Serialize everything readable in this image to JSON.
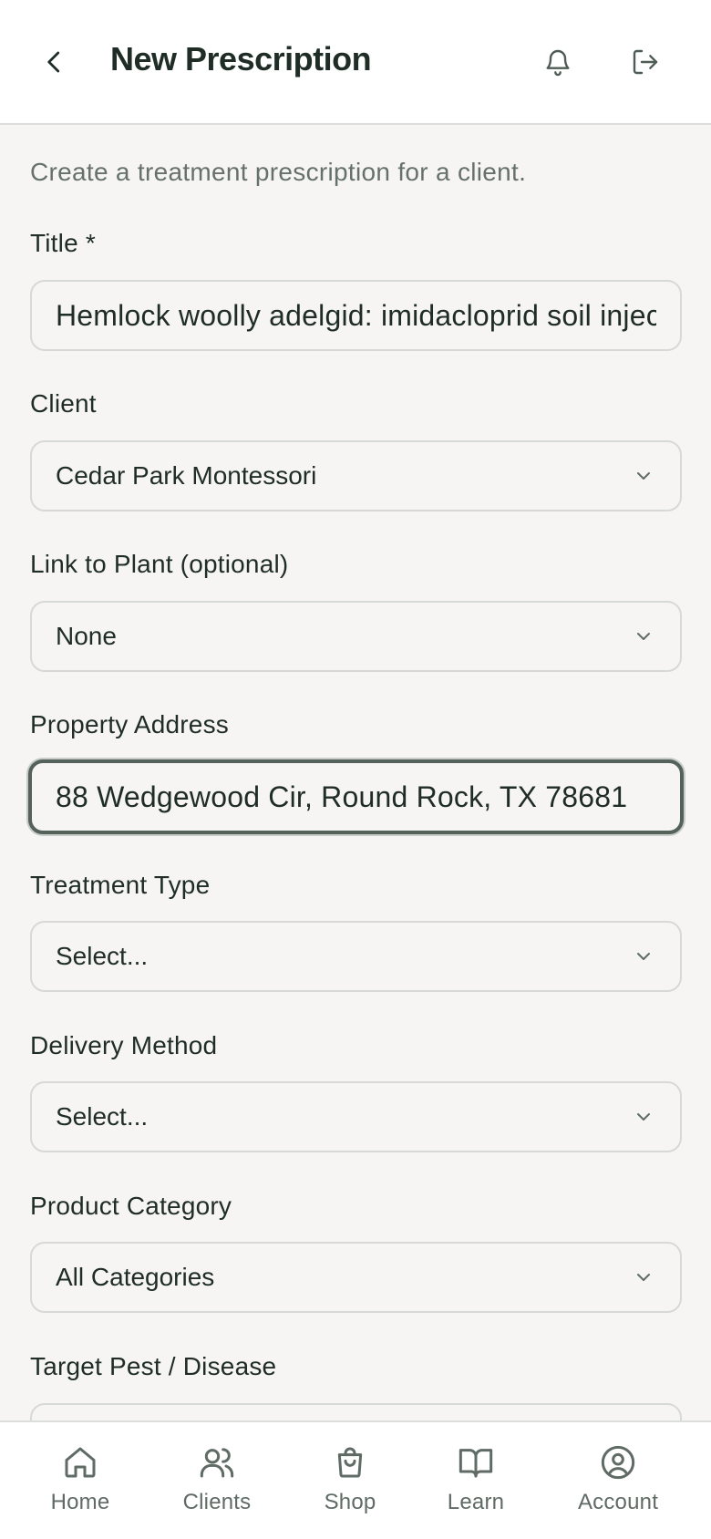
{
  "header": {
    "title": "New Prescription"
  },
  "intro": "Create a treatment prescription for a client.",
  "form": {
    "title_label": "Title *",
    "title_value": "Hemlock woolly adelgid: imidacloprid soil injection",
    "client_label": "Client",
    "client_value": "Cedar Park Montessori",
    "plant_label": "Link to Plant (optional)",
    "plant_value": "None",
    "address_label": "Property Address",
    "address_value": "88 Wedgewood Cir, Round Rock, TX 78681",
    "treatment_label": "Treatment Type",
    "treatment_value": "Select...",
    "delivery_label": "Delivery Method",
    "delivery_value": "Select...",
    "category_label": "Product Category",
    "category_value": "All Categories",
    "pest_label": "Target Pest / Disease"
  },
  "nav": {
    "home": "Home",
    "clients": "Clients",
    "shop": "Shop",
    "learn": "Learn",
    "account": "Account"
  },
  "colors": {
    "text": "#1f2d26",
    "muted": "#667269",
    "background": "#f6f5f3",
    "border": "#d6d9d5"
  }
}
